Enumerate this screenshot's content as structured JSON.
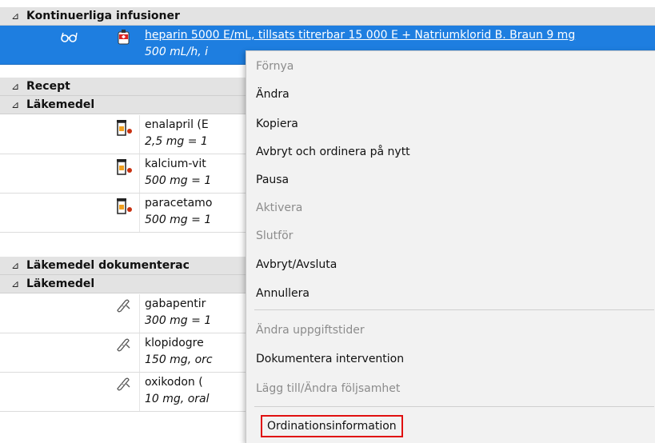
{
  "groups": [
    {
      "label": "Kontinuerliga infusioner",
      "expander": "⊿"
    },
    {
      "label": "Recept",
      "expander": "⊿"
    },
    {
      "label": "Läkemedel",
      "expander": "⊿"
    },
    {
      "label": "Läkemedel dokumenterac",
      "expander": "⊿"
    },
    {
      "label": "Läkemedel",
      "expander": "⊿"
    }
  ],
  "rows": [
    {
      "line1": "heparin 5000 E/mL, tillsats titrerbar 15 000 E + Natriumklorid B. Braun 9 mg",
      "line2": "500 mL/h, i",
      "icon": "infusion-bag-icon",
      "status_icon": "glasses-icon"
    },
    {
      "line1": "enalapril (E",
      "line2": "2,5 mg = 1",
      "icon": "pill-bottle-icon"
    },
    {
      "line1": "kalcium-vit",
      "line2": "500 mg = 1",
      "icon": "pill-bottle-icon"
    },
    {
      "line1": "paracetamo",
      "line2": "500 mg = 1",
      "icon": "pill-bottle-icon"
    },
    {
      "line1": "gabapentir",
      "line2": "300 mg = 1",
      "icon": "bandage-icon"
    },
    {
      "line1": "klopidogre",
      "line2": "150 mg, orc",
      "icon": "bandage-icon"
    },
    {
      "line1": "oxikodon (",
      "line2": "10 mg, oral",
      "icon": "bandage-icon"
    }
  ],
  "context_menu": {
    "items": [
      {
        "label": "Förnya",
        "enabled": false
      },
      {
        "label": "Ändra",
        "enabled": true
      },
      {
        "label": "Kopiera",
        "enabled": true
      },
      {
        "label": "Avbryt och ordinera på nytt",
        "enabled": true
      },
      {
        "label": "Pausa",
        "enabled": true
      },
      {
        "label": "Aktivera",
        "enabled": false
      },
      {
        "label": "Slutför",
        "enabled": false
      },
      {
        "label": "Avbryt/Avsluta",
        "enabled": true
      },
      {
        "label": "Annullera",
        "enabled": true
      },
      {
        "label": "Ändra uppgiftstider",
        "enabled": false
      },
      {
        "label": "Dokumentera intervention",
        "enabled": true
      },
      {
        "label": "Lägg till/Ändra följsamhet",
        "enabled": false
      },
      {
        "label": "Ordinationsinformation",
        "enabled": true,
        "highlighted": true
      }
    ]
  },
  "colors": {
    "selection": "#1e7ee0",
    "highlight_border": "#e01010",
    "group_header": "#e3e3e3"
  }
}
